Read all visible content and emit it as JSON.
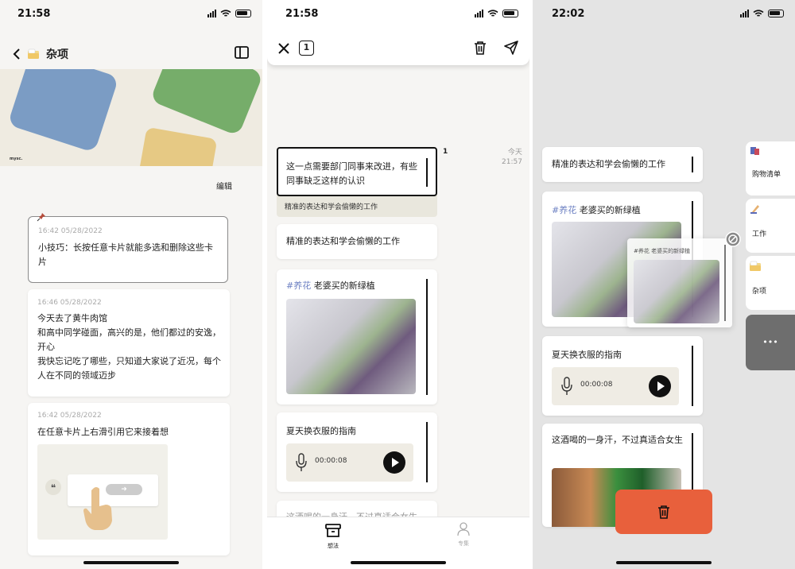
{
  "status": {
    "p1_time": "21:58",
    "p2_time": "21:58",
    "p3_time": "22:02"
  },
  "p1": {
    "title": "杂项",
    "edit_label": "编辑",
    "banner_caption": "mysc.",
    "cards": [
      {
        "meta": "16:42  05/28/2022",
        "text": "小技巧：长按任意卡片就能多选和删除这些卡片"
      },
      {
        "meta": "16:46  05/28/2022",
        "text": "今天去了黄牛肉馆\n和高中同学碰面，高兴的是，他们都过的安逸，开心\n我快忘记吃了哪些，只知道大家说了近况，每个人在不同的领域迈步"
      },
      {
        "meta": "16:42  05/28/2022",
        "text": "在任意卡片上右滑引用它来接着想"
      }
    ]
  },
  "p2": {
    "count": "1",
    "quote_text": "这一点需要部门同事来改进，有些同事缺乏这样的认识",
    "quote_badge": "1",
    "quote_source": "精准的表达和学会偷懒的工作",
    "time_day": "今天",
    "time_clock": "21:57",
    "card1": "精准的表达和学会偷懒的工作",
    "card2_tag": "#养花",
    "card2_text": " 老婆买的新绿植",
    "card3": "夏天换衣服的指南",
    "audio_time": "00:00:08",
    "card4_peek": "这酒喝的一身汗，不过真适合女生",
    "tab_ideas": "想法",
    "tab_collections": "专集"
  },
  "p3": {
    "card1": "精准的表达和学会偷懒的工作",
    "card2_tag": "#养花",
    "card2_text": " 老婆买的新绿植",
    "drag_caption": "#养花 老婆买的新绿植",
    "card3": "夏天换衣服的指南",
    "audio_time": "00:00:08",
    "card4": "这酒喝的一身汗，不过真适合女生",
    "side": [
      {
        "label": "购物清单"
      },
      {
        "label": "工作"
      },
      {
        "label": "杂项"
      }
    ],
    "more": "•••"
  },
  "colors": {
    "accent": "#e8603c",
    "tag": "#6b7fc2",
    "banner_bg": "#efebe1"
  }
}
